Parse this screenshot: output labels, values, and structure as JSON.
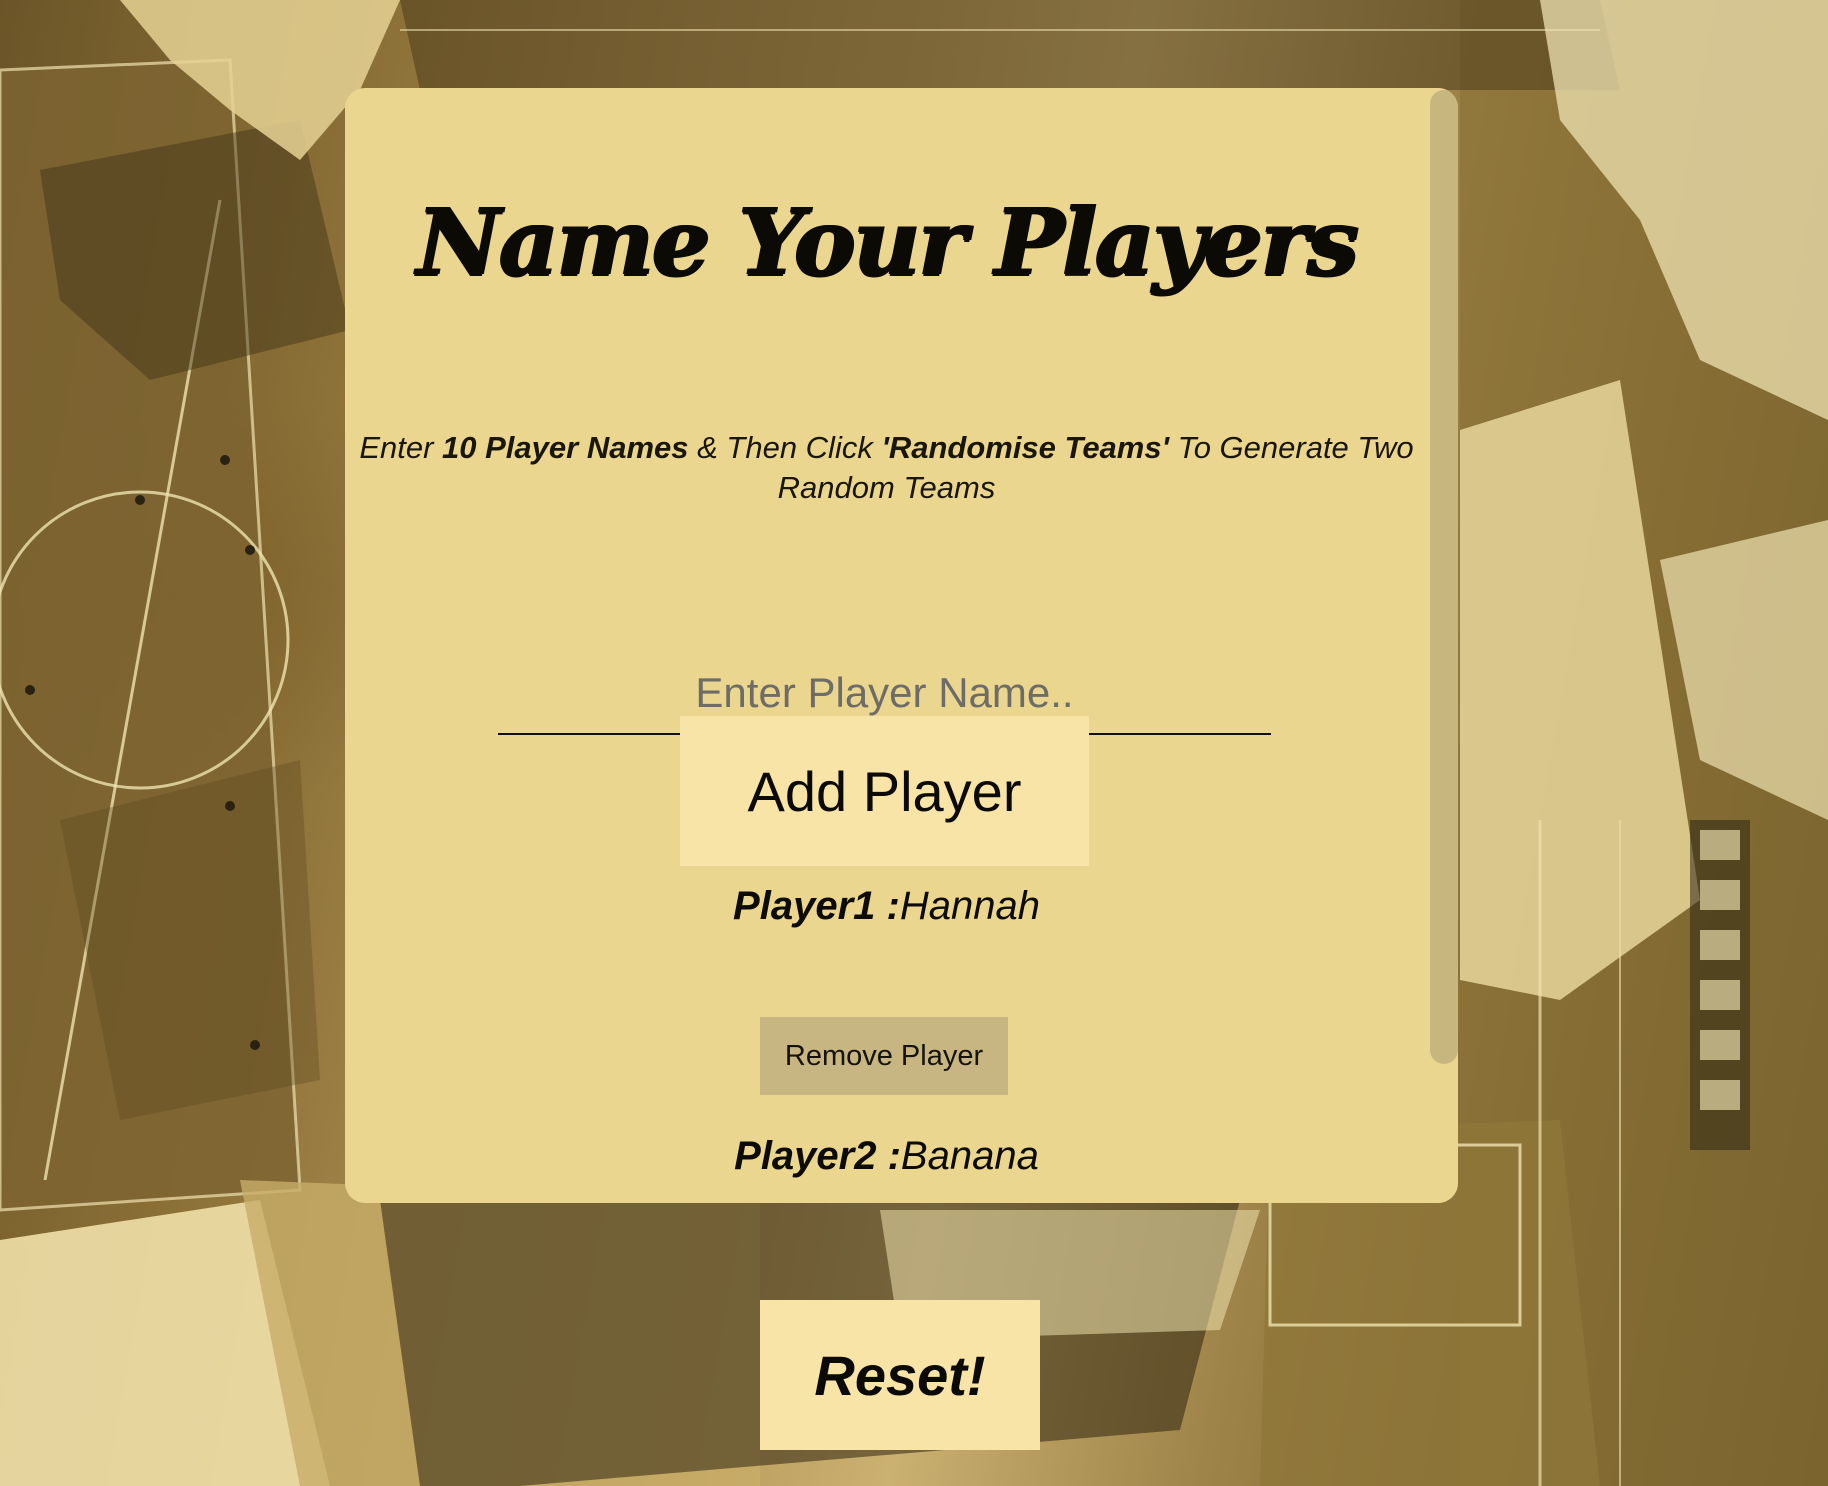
{
  "page": {
    "title": "Name Your Players",
    "instructions": {
      "part1": "Enter ",
      "bold1": "10 Player Names",
      "part2": " & Then Click ",
      "bold2": "'Randomise Teams'",
      "part3": " To Generate Two Random Teams"
    }
  },
  "form": {
    "placeholder": "Enter Player Name..",
    "value": "",
    "add_label": "Add Player"
  },
  "players": [
    {
      "label": "Player1 :",
      "name": "Hannah",
      "remove_label": "Remove Player"
    },
    {
      "label": "Player2 :",
      "name": "Banana"
    }
  ],
  "footer": {
    "reset_label": "Reset!"
  },
  "colors": {
    "card": "#ead68f",
    "button": "#f7e4a6",
    "remove_button": "#c7b582",
    "scroll_thumb": "#c8b67f",
    "text": "#0c0a04"
  }
}
